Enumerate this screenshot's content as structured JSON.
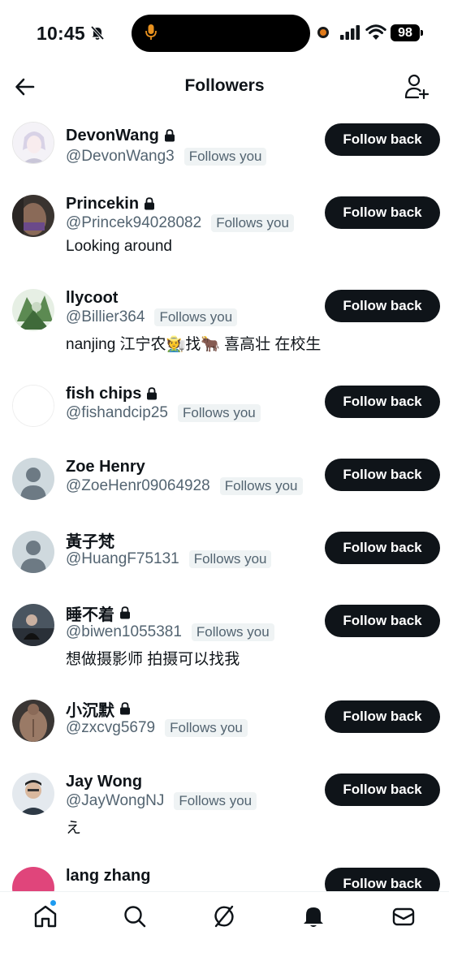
{
  "status_bar": {
    "time": "10:45",
    "battery": "98"
  },
  "header": {
    "title": "Followers"
  },
  "badge_label": "Follows you",
  "follow_label": "Follow back",
  "followers": [
    {
      "name": "DevonWang",
      "handle": "@DevonWang3",
      "locked": true,
      "bio": "",
      "avatar": "anime"
    },
    {
      "name": "Princekin",
      "handle": "@Princek94028082",
      "locked": true,
      "bio": "Looking around",
      "avatar": "photo-dark"
    },
    {
      "name": "llycoot",
      "handle": "@Billier364",
      "locked": false,
      "bio": "nanjing 江宁农🧑‍🌾找🐂 喜高壮 在校生",
      "avatar": "photo-green"
    },
    {
      "name": "fish chips",
      "handle": "@fishandcip25",
      "locked": true,
      "bio": "",
      "avatar": "blank"
    },
    {
      "name": "Zoe Henry",
      "handle": "@ZoeHenr09064928",
      "locked": false,
      "bio": "",
      "avatar": "default"
    },
    {
      "name": "黃子梵",
      "handle": "@HuangF75131",
      "locked": false,
      "bio": "",
      "avatar": "default"
    },
    {
      "name": "睡不着",
      "handle": "@biwen1055381",
      "locked": true,
      "bio": "想做摄影师 拍摄可以找我",
      "avatar": "photo-dark"
    },
    {
      "name": "小沉默",
      "handle": "@zxcvg5679",
      "locked": true,
      "bio": "",
      "avatar": "photo-dark"
    },
    {
      "name": "Jay Wong",
      "handle": "@JayWongNJ",
      "locked": false,
      "bio": "え",
      "avatar": "photo-light"
    },
    {
      "name": "lang zhang",
      "handle": "",
      "locked": false,
      "bio": "",
      "avatar": "pink"
    }
  ],
  "nav": [
    "home-icon",
    "search-icon",
    "grok-icon",
    "notifications-icon",
    "messages-icon"
  ],
  "colors": {
    "button_bg": "#0f1419",
    "secondary_text": "#536471",
    "badge_bg": "#eff3f4",
    "accent": "#1d9bf0"
  }
}
